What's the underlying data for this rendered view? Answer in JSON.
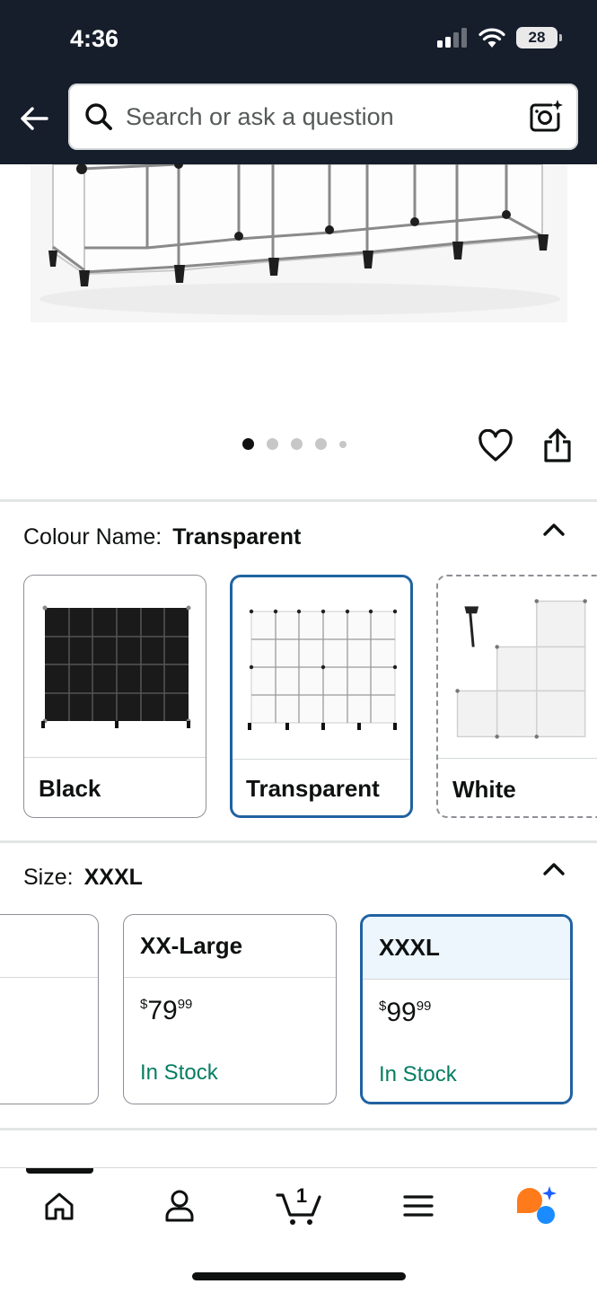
{
  "status_bar": {
    "time": "4:36",
    "battery": "28"
  },
  "search": {
    "placeholder": "Search or ask a question"
  },
  "gallery": {
    "page_count": 5,
    "active_index": 0
  },
  "colour": {
    "label": "Colour Name:",
    "selected": "Transparent",
    "options": [
      {
        "label": "Black",
        "state": "available"
      },
      {
        "label": "Transparent",
        "state": "selected"
      },
      {
        "label": "White",
        "state": "unavailable"
      }
    ]
  },
  "size": {
    "label": "Size:",
    "selected": "XXXL",
    "options": [
      {
        "label": "XX-Large",
        "price_symbol": "$",
        "price_whole": "79",
        "price_fraction": "99",
        "stock": "In Stock"
      },
      {
        "label": "XXXL",
        "price_symbol": "$",
        "price_whole": "99",
        "price_fraction": "99",
        "stock": "In Stock"
      }
    ]
  },
  "bottom_nav": {
    "items": [
      "home-icon",
      "account-icon",
      "cart-icon",
      "menu-icon",
      "rufus-icon"
    ],
    "cart_count": "1"
  },
  "colors": {
    "header_bg": "#161d2b",
    "selected_border": "#2162a1",
    "in_stock": "#067d62",
    "rufus_orange": "#ff7a1a",
    "rufus_blue": "#1a8cff"
  }
}
